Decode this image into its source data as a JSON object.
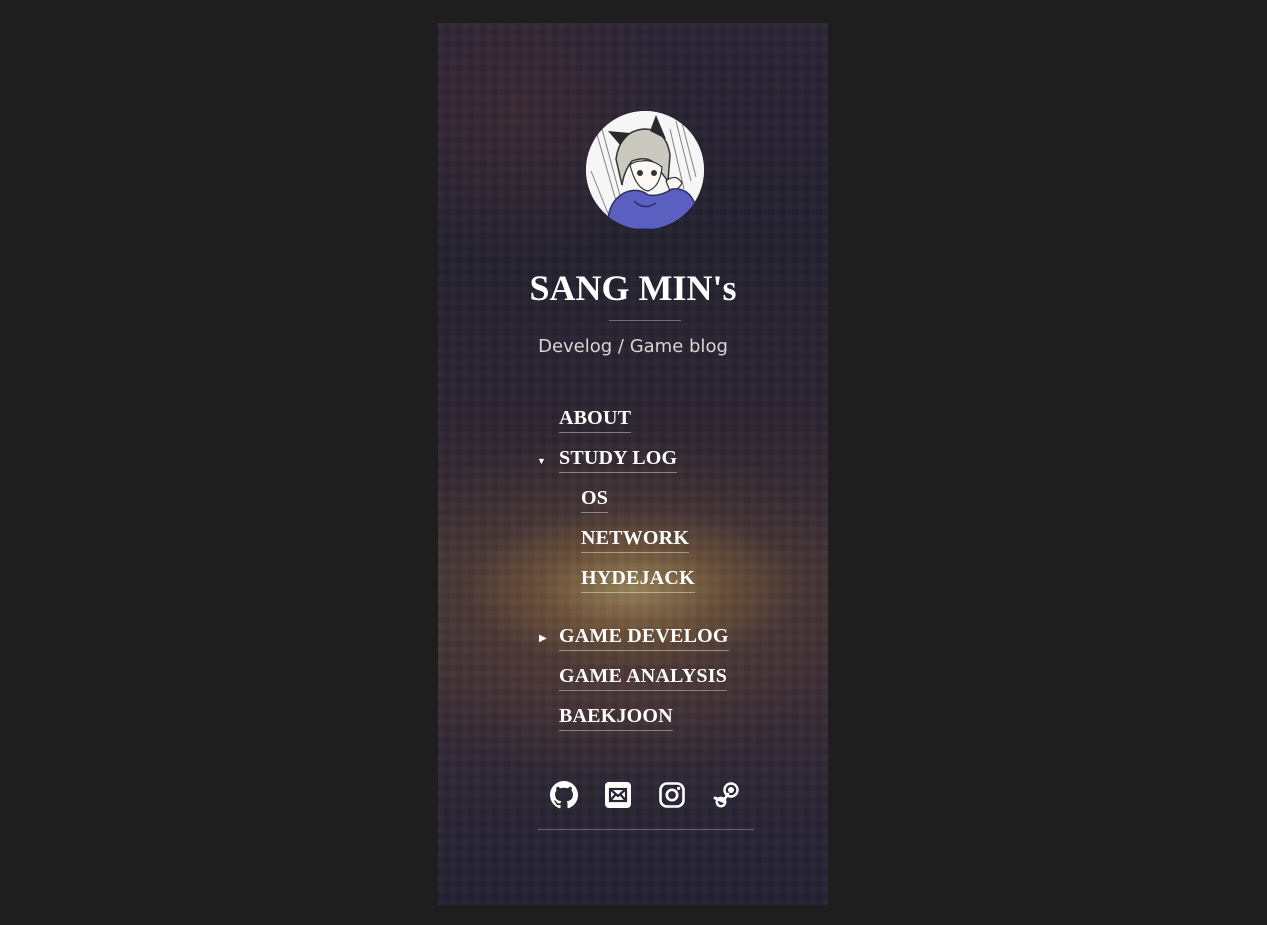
{
  "sidebar": {
    "title": "SANG MIN's",
    "tagline": "Develog / Game blog",
    "nav": {
      "about": "ABOUT",
      "study_log": "STUDY LOG",
      "os": "OS",
      "network": "NETWORK",
      "hydejack": "HYDEJACK",
      "game_develog": "GAME DEVELOG",
      "game_analysis": "GAME ANALYSIS",
      "baekjoon": "BAEKJOON"
    },
    "carets": {
      "expanded": "▼",
      "collapsed": "▶"
    },
    "social_icons": [
      "github-icon",
      "email-icon",
      "instagram-icon",
      "steam-icon"
    ]
  },
  "colors": {
    "page_background": "#1e1e1e",
    "text": "#ffffff",
    "tagline": "#d6d6d6",
    "avatar_hoodie": "#5a5fc0"
  }
}
